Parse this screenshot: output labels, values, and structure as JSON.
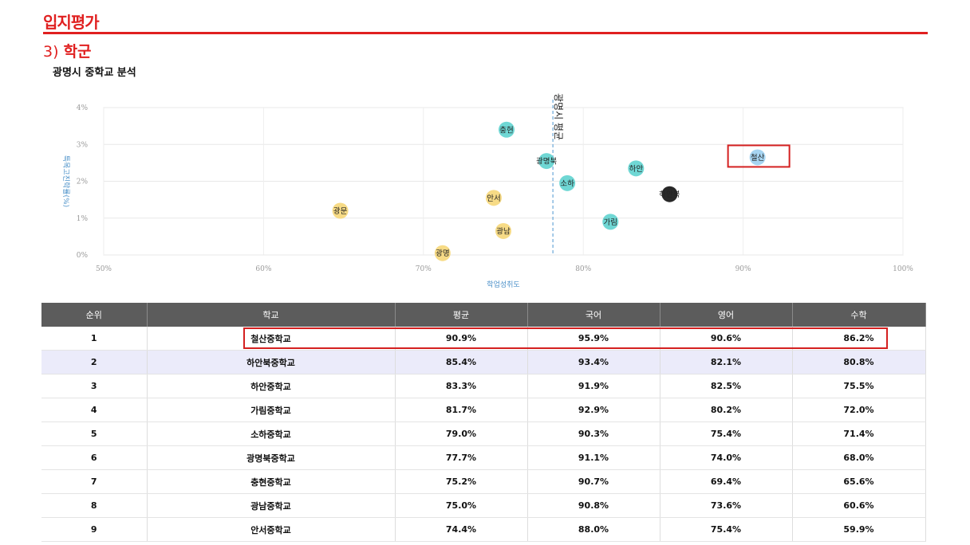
{
  "header": {
    "title": "입지평가",
    "section_number": "3)",
    "section_name": "학군"
  },
  "colors": {
    "accent": "#e02020",
    "teal": "#5fd3cf",
    "yellow": "#f6d779",
    "black": "#111111",
    "blue": "#9ccff0"
  },
  "chart_data": {
    "type": "scatter",
    "title": "광명시 중학교 분석",
    "xlabel": "학업성취도",
    "ylabel": "특목고진학률(%)",
    "xlim": [
      50,
      100
    ],
    "ylim": [
      0,
      4
    ],
    "x_ticks": [
      "50%",
      "60%",
      "70%",
      "80%",
      "90%",
      "100%"
    ],
    "y_ticks": [
      "0%",
      "1%",
      "2%",
      "3%",
      "4%"
    ],
    "grid": true,
    "reference_line": {
      "x": 78.1,
      "label": "광명시 평균"
    },
    "highlight_point": "철산",
    "points": [
      {
        "name": "충현",
        "x": 75.2,
        "y": 3.4,
        "color": "teal"
      },
      {
        "name": "광명북",
        "x": 77.7,
        "y": 2.55,
        "color": "teal"
      },
      {
        "name": "소하",
        "x": 79.0,
        "y": 1.95,
        "color": "teal"
      },
      {
        "name": "하안",
        "x": 83.3,
        "y": 2.35,
        "color": "teal"
      },
      {
        "name": "가림",
        "x": 81.7,
        "y": 0.9,
        "color": "teal"
      },
      {
        "name": "하안북",
        "x": 85.4,
        "y": 1.65,
        "color": "black"
      },
      {
        "name": "철산",
        "x": 90.9,
        "y": 2.65,
        "color": "blue"
      },
      {
        "name": "광문",
        "x": 64.8,
        "y": 1.2,
        "color": "yellow"
      },
      {
        "name": "안서",
        "x": 74.4,
        "y": 1.55,
        "color": "yellow"
      },
      {
        "name": "광남",
        "x": 75.0,
        "y": 0.65,
        "color": "yellow"
      },
      {
        "name": "광명",
        "x": 71.2,
        "y": 0.05,
        "color": "yellow"
      }
    ]
  },
  "table": {
    "headers": [
      "순위",
      "학교",
      "평균",
      "국어",
      "영어",
      "수학"
    ],
    "rows": [
      [
        "1",
        "철산중학교",
        "90.9%",
        "95.9%",
        "90.6%",
        "86.2%"
      ],
      [
        "2",
        "하안북중학교",
        "85.4%",
        "93.4%",
        "82.1%",
        "80.8%"
      ],
      [
        "3",
        "하안중학교",
        "83.3%",
        "91.9%",
        "82.5%",
        "75.5%"
      ],
      [
        "4",
        "가림중학교",
        "81.7%",
        "92.9%",
        "80.2%",
        "72.0%"
      ],
      [
        "5",
        "소하중학교",
        "79.0%",
        "90.3%",
        "75.4%",
        "71.4%"
      ],
      [
        "6",
        "광명북중학교",
        "77.7%",
        "91.1%",
        "74.0%",
        "68.0%"
      ],
      [
        "7",
        "충현중학교",
        "75.2%",
        "90.7%",
        "69.4%",
        "65.6%"
      ],
      [
        "8",
        "광남중학교",
        "75.0%",
        "90.8%",
        "73.6%",
        "60.6%"
      ],
      [
        "9",
        "안서중학교",
        "74.4%",
        "88.0%",
        "75.4%",
        "59.9%"
      ]
    ]
  }
}
